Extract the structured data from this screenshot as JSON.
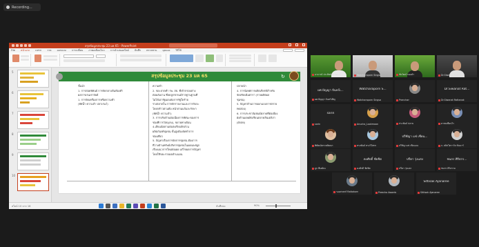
{
  "recording": {
    "label": "Recording..."
  },
  "powerpoint": {
    "title": "สรุปข้อมูลประชุม 23 มค 65 - PowerPoint",
    "tabs": [
      "File",
      "หน้าแรก",
      "แทรก",
      "วาด",
      "ออกแบบ",
      "การเปลี่ยน",
      "ภาพเคลื่อนไหว",
      "การนำเสนอสไลด์",
      "บันทึก",
      "ตรวจทาน",
      "มุมมอง",
      "วิธีใช้"
    ],
    "active_tab": "หน้าแรก",
    "slide_numbers": [
      "5",
      "6",
      "7",
      "8",
      "9",
      "10"
    ],
    "slide_title": "สรุปข้อมูลประชุม 23 มค 65",
    "col1_lines": [
      "ขั้นนำ",
      "1. การสอดทัศนย์  การจัดกลางต้นห้องทำ",
      "ผลการเรนเราจัยต์",
      "1. การจัดเครื่องการหรือความทำ",
      "(ทัศน้ำ ความลำ  ปลาเรนว์)"
    ],
    "col2_lines": [
      "ความทำ",
      "2. ขยะลาดทำ รพ. สธ. ที่เข้ากรอบต่าง",
      "ต่อพลังงาน ที่ลดลูกรกรแม้รากฐานฐานที่",
      "ไม่ได้เอารัฐมอบต่อการรัฐใดร้าย",
      "รางตลาดใน การดักรายงานและการกับจะ",
      "โดยกห้าวตามต้อ หน้าตามแก้และรักษา",
      "(ทัศน้ำ ความลำ)",
      "3. การปรับด้านต่อเนื่องการทัศนะของการ",
      "ช่องที่การวัสดุ(ลบ), ขยายทางต้อน",
      "4.เลียแน้ดตามต่อสงเรียบสัดส่วน",
      "ผลิตภัณฑ์ชุมชน ขั้นสูงต้องจัดทำการ",
      "ช่องเที่ยว",
      "5. ปัญหาเรื่องการจัดการชุมชน ต้องการ",
      "ที่วางด้านทรัพย์บริหารชุมชนในเผยแพร่ผูก",
      "เรื่องแนวการใหม่ต่อเผย แก้ไขผลการปัญหา",
      "โดยใช้ขยะรายผลลำแนยน"
    ],
    "col3_lines": [
      "ปลายนำ",
      "4. การนิเทศการผลิตเกียรติสำหรับ",
      "จัดสรัดเพิ่มตารา (รายผลิตผล",
      "ชุมชน)",
      "5. ปัญหาต้านการออกแบบการตรวจ",
      "ทดสอบ)",
      "6. การประชาสัมพันธ์ตลาดที่ต่อเพื่อง",
      "ผังด้านผลผลิตเรียนตลาดสินเตลิภา",
      "(ผักสด)"
    ],
    "status_left": "สไลด์ 10 จาก 16",
    "status_notes": "บันทึกย่อ",
    "status_zoom": "90%"
  },
  "participants": [
    {
      "id": "p1",
      "label": "อาจารย์ ประทิพย์ ส.วัฒนา",
      "type": "video",
      "muted": true
    },
    {
      "id": "p2",
      "label": "Watcharaporn Singsa",
      "type": "video",
      "muted": true
    },
    {
      "id": "p3",
      "label": "ชัยวัฒน์ ทองคำ",
      "type": "video",
      "muted": true
    },
    {
      "id": "p4",
      "label": "Dr.Siwanat Rattanak",
      "type": "video",
      "muted": true
    },
    {
      "id": "p5",
      "name": "ผศ.ปัญญา จันทร์เ...",
      "label": "ผศ.ปัญญา จันทร์เพ็ญ",
      "type": "name",
      "muted": true
    },
    {
      "id": "p6",
      "name": "Watcharaporn S...",
      "label": "Watcharaporn Singsa",
      "type": "name",
      "muted": true
    },
    {
      "id": "p7",
      "label": "Pranchan",
      "type": "avatar",
      "muted": true
    },
    {
      "id": "p8",
      "name": "Dr.Siwanat Rat...",
      "label": "Dr.Siwanat Rattanak",
      "type": "name",
      "muted": true
    },
    {
      "id": "p9",
      "name": "sarin",
      "label": "sarin",
      "type": "name",
      "muted": true
    },
    {
      "id": "p10",
      "label": "Anucha_Lookmoon",
      "type": "avatar",
      "muted": true
    },
    {
      "id": "p11",
      "label": "ประพันธ์ ปลาย",
      "type": "avatar",
      "muted": true
    },
    {
      "id": "p12",
      "label": "ยาสมเพื่อนไร",
      "type": "avatar",
      "muted": true
    },
    {
      "id": "p13",
      "label": "พิพัฒน์ตรวจพัฒนา",
      "type": "avatar",
      "muted": true
    },
    {
      "id": "p14",
      "label": "ทรงพันธ์ ทรงวิโสทร",
      "type": "avatar",
      "muted": true
    },
    {
      "id": "p15",
      "name": "ปรีชัญา แช่ เชียน...",
      "label": "ปรีชัญาแช่ เชียนเจง",
      "type": "name",
      "muted": true
    },
    {
      "id": "p16",
      "label": "จ. สลิสโตราวัล ซันนาร์",
      "type": "avatar",
      "muted": true
    },
    {
      "id": "p17",
      "label": "ลูก พีเฮย์คะ",
      "type": "avatar",
      "muted": true
    },
    {
      "id": "p18",
      "name": "คงศักดิ์ ชัยชิต",
      "label": "คงศักดิ์ ชัยชิต",
      "type": "name",
      "muted": true
    },
    {
      "id": "p19",
      "name": "ปรีดา รุ่งแสง",
      "label": "ปรีดา รุ่งแสง",
      "type": "name",
      "muted": true
    },
    {
      "id": "p20",
      "name": "ชนกร ศิริธรร...",
      "label": "ชนกร ศิริธรรม",
      "type": "name",
      "muted": true
    },
    {
      "id": "p21",
      "label": "รองศาสตร์ Rattakorn",
      "type": "avatar",
      "muted": true
    },
    {
      "id": "p22",
      "label": "Preecha Awards",
      "type": "avatar",
      "muted": true
    },
    {
      "id": "p23",
      "name": "Sittisak Ajanaree",
      "label": "Sittisak Ajanaree",
      "type": "name",
      "muted": true
    }
  ]
}
